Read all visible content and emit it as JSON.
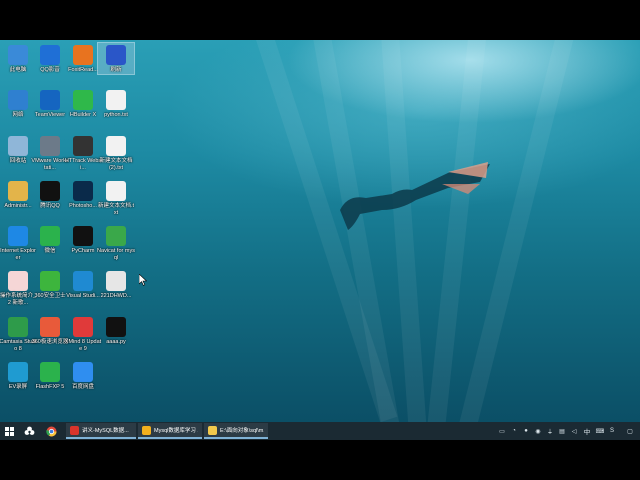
{
  "desktop_icons": [
    {
      "id": "this-pc",
      "label": "此电脑",
      "icon": "computer-icon",
      "color": "#3a8ad8"
    },
    {
      "id": "qq-video",
      "label": "QQ影音",
      "icon": "qq-video-icon",
      "color": "#1f6fd6"
    },
    {
      "id": "foxit",
      "label": "FoxitRead...",
      "icon": "foxit-reader-icon",
      "color": "#e8731f"
    },
    {
      "id": "broom",
      "label": "刷新",
      "icon": "broom-icon",
      "color": "#2a56c8",
      "selected": true
    },
    {
      "id": "network",
      "label": "网络",
      "icon": "network-icon",
      "color": "#2f80d0"
    },
    {
      "id": "teamviewer",
      "label": "TeamViewer",
      "icon": "teamviewer-icon",
      "color": "#1565c0"
    },
    {
      "id": "hbuilder",
      "label": "HBuilder X",
      "icon": "hbuilder-icon",
      "color": "#2fb84a"
    },
    {
      "id": "python-txt",
      "label": "python.txt",
      "icon": "text-file-icon",
      "color": "#f2f2f2"
    },
    {
      "id": "recycle-bin",
      "label": "回收站",
      "icon": "recycle-bin-icon",
      "color": "#8fb6d8"
    },
    {
      "id": "vmware",
      "label": "VMware Workstati...",
      "icon": "vmware-icon",
      "color": "#6c7a89"
    },
    {
      "id": "httrack",
      "label": "HTTrack Websi...",
      "icon": "httrack-icon",
      "color": "#333333"
    },
    {
      "id": "new-text-1",
      "label": "新建文本文档 (2).txt",
      "icon": "text-file-icon",
      "color": "#f2f2f2"
    },
    {
      "id": "administrator",
      "label": "Administr...",
      "icon": "user-folder-icon",
      "color": "#e3b44a"
    },
    {
      "id": "tencent-qq",
      "label": "腾讯QQ",
      "icon": "qq-penguin-icon",
      "color": "#111111"
    },
    {
      "id": "photoshop",
      "label": "Photosho...",
      "icon": "photoshop-icon",
      "color": "#0a2a4a"
    },
    {
      "id": "new-text-2",
      "label": "新建文本文档.txt",
      "icon": "text-file-icon",
      "color": "#f2f2f2"
    },
    {
      "id": "ie",
      "label": "Internet Explorer",
      "icon": "internet-explorer-icon",
      "color": "#1e88e5"
    },
    {
      "id": "wechat",
      "label": "微信",
      "icon": "wechat-icon",
      "color": "#2bb24c"
    },
    {
      "id": "pycharm",
      "label": "PyCharm",
      "icon": "pycharm-icon",
      "color": "#111111"
    },
    {
      "id": "navicat",
      "label": "Navicat for mysql",
      "icon": "navicat-icon",
      "color": "#3aa84a"
    },
    {
      "id": "os-intro",
      "label": "操作系统简介_2 新歌...",
      "icon": "document-icon",
      "color": "#f5d6d6"
    },
    {
      "id": "360-guard",
      "label": "360安全卫士",
      "icon": "360-guard-icon",
      "color": "#3db53d"
    },
    {
      "id": "vscode",
      "label": "Visual Studi...",
      "icon": "vscode-icon",
      "color": "#1f8ad2"
    },
    {
      "id": "221dhwd",
      "label": "221DHWD...",
      "icon": "keyboard-icon",
      "color": "#e6e6e6"
    },
    {
      "id": "camtasia",
      "label": "Camtasia Studio 8",
      "icon": "camtasia-icon",
      "color": "#2e9b4a"
    },
    {
      "id": "360-browser",
      "label": "360极速浏览器",
      "icon": "360-browser-icon",
      "color": "#e85a3a"
    },
    {
      "id": "xmind",
      "label": "XMind 8 Update 9",
      "icon": "xmind-icon",
      "color": "#e03a3a"
    },
    {
      "id": "aaaa-py",
      "label": "aaaa.py",
      "icon": "pycharm-file-icon",
      "color": "#111111"
    },
    {
      "id": "ev-recorder",
      "label": "EV录屏",
      "icon": "ev-recorder-icon",
      "color": "#1f9bd1"
    },
    {
      "id": "flashfxp",
      "label": "FlashFXP 5",
      "icon": "flashfxp-icon",
      "color": "#2bb24c"
    },
    {
      "id": "baidu-netdisk",
      "label": "百度网盘",
      "icon": "baidu-netdisk-icon",
      "color": "#2f8ef0"
    }
  ],
  "taskbar": {
    "start_icon": "windows-start-icon",
    "tasks": [
      {
        "label": "讲义-MySQL数据...",
        "icon": "wps-icon",
        "color": "#d9342b"
      },
      {
        "label": "Mysql数据库学习 ...",
        "icon": "chrome-icon",
        "color": "#f2b01e"
      },
      {
        "label": "E:\\面向对象\\sql\\m...",
        "icon": "folder-icon",
        "color": "#f2c94c"
      }
    ],
    "tray": {
      "ime_label": "中"
    }
  }
}
